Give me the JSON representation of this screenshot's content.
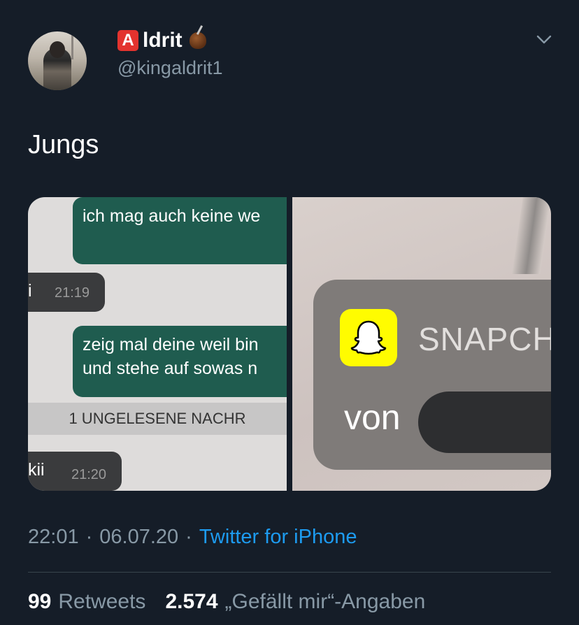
{
  "author": {
    "badge_letter": "A",
    "name": "ldrit",
    "handle": "@kingaldrit1",
    "avatar_icon": "profile-photo",
    "emoji_icon": "mate-icon"
  },
  "menu_icon": "chevron-down-icon",
  "tweet": {
    "text": "Jungs"
  },
  "media": {
    "left_image": {
      "bubble1": "ich mag auch keine we",
      "incoming1_text": "i",
      "incoming1_time": "21:19",
      "bubble2_line1": "zeig mal deine weil bin",
      "bubble2_line2": "und stehe auf sowas n",
      "unread_bar": "1 UNGELESENE NACHR",
      "incoming2_text": "kii",
      "incoming2_time": "21:20"
    },
    "right_image": {
      "app_title": "SNAPCH",
      "from_label": "von",
      "logo_icon": "snapchat-ghost-icon"
    }
  },
  "meta": {
    "time": "22:01",
    "sep1": "·",
    "date": "06.07.20",
    "sep2": "·",
    "source": "Twitter for iPhone"
  },
  "stats": {
    "retweets_count": "99",
    "retweets_label": "Retweets",
    "likes_count": "2.574",
    "likes_label": "„Gefällt mir“-Angaben"
  },
  "colors": {
    "background": "#151d28",
    "secondary_text": "#8899a6",
    "link": "#1d9bf0",
    "whatsapp_outgoing": "#1f5c4f",
    "snapchat_yellow": "#fffc00"
  }
}
